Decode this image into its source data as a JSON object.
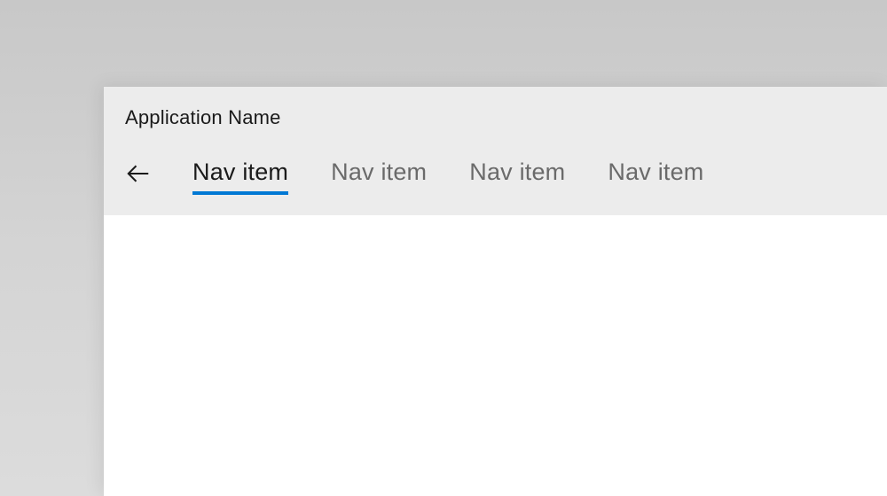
{
  "app": {
    "title": "Application Name"
  },
  "nav": {
    "items": [
      {
        "label": "Nav item",
        "active": true
      },
      {
        "label": "Nav item",
        "active": false
      },
      {
        "label": "Nav item",
        "active": false
      },
      {
        "label": "Nav item",
        "active": false
      }
    ]
  },
  "colors": {
    "accent": "#0078d4",
    "header_bg": "#ececec",
    "inactive_text": "#6a6a6a",
    "active_text": "#1a1a1a"
  }
}
